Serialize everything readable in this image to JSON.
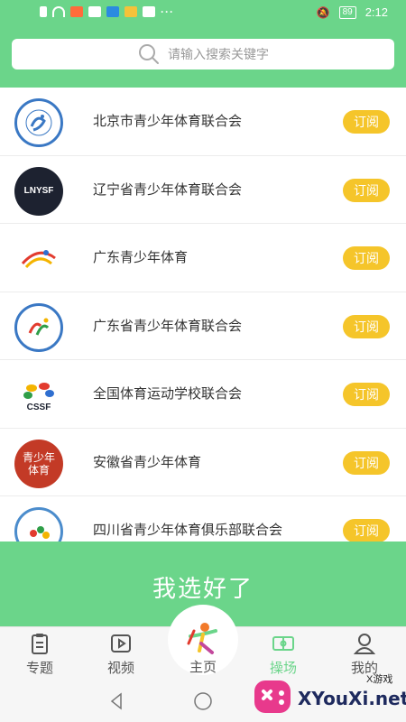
{
  "status_bar": {
    "time": "2:12",
    "battery": "89"
  },
  "search": {
    "placeholder": "请输入搜索关键字"
  },
  "list": [
    {
      "name": "北京市青少年体育联合会",
      "button": "订阅"
    },
    {
      "name": "辽宁省青少年体育联合会",
      "button": "订阅",
      "logo_text": "LNYSF"
    },
    {
      "name": "广东青少年体育",
      "button": "订阅"
    },
    {
      "name": "广东省青少年体育联合会",
      "button": "订阅"
    },
    {
      "name": "全国体育运动学校联合会",
      "button": "订阅",
      "logo_text": "CSSF"
    },
    {
      "name": "安徽省青少年体育",
      "button": "订阅",
      "logo_text": "青少年体育"
    },
    {
      "name": "四川省青少年体育俱乐部联合会",
      "button": "订阅"
    }
  ],
  "confirm_button": "我选好了",
  "tabs": [
    {
      "label": "专题",
      "icon": "clipboard-icon"
    },
    {
      "label": "视频",
      "icon": "video-icon"
    },
    {
      "label": "主页",
      "icon": "home-logo-icon"
    },
    {
      "label": "操场",
      "icon": "field-icon",
      "active": true
    },
    {
      "label": "我的",
      "icon": "person-icon"
    }
  ],
  "watermark": {
    "text": "XYouXi.net",
    "small": "X游戏"
  },
  "colors": {
    "primary": "#6bd58a",
    "subscribe": "#f5c52a"
  }
}
